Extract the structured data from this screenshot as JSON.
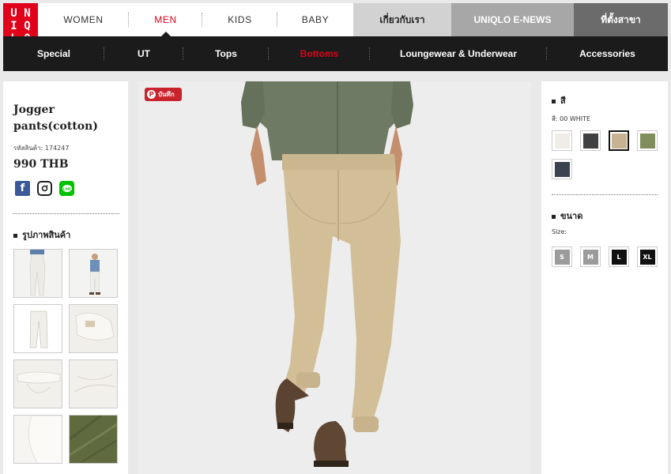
{
  "brand": {
    "logo_text": [
      "UNI",
      "QLO"
    ],
    "color": "#e0001a"
  },
  "global_nav": [
    {
      "label": "WOMEN",
      "active": false
    },
    {
      "label": "MEN",
      "active": true
    },
    {
      "label": "KIDS",
      "active": false
    },
    {
      "label": "BABY",
      "active": false
    }
  ],
  "external_links": [
    {
      "label": "เกี่ยวกับเรา",
      "bg": "#d2d2d2",
      "color": "#222"
    },
    {
      "label": "UNIQLO E-NEWS",
      "bg": "#a7a7a7",
      "color": "#fff"
    },
    {
      "label": "ที่ตั้งสาขา",
      "bg": "#6b6b6b",
      "color": "#fff"
    }
  ],
  "category_nav": [
    {
      "label": "Special",
      "active": false
    },
    {
      "label": "UT",
      "active": false
    },
    {
      "label": "Tops",
      "active": false
    },
    {
      "label": "Bottoms",
      "active": true
    },
    {
      "label": "Loungewear & Underwear",
      "active": false
    },
    {
      "label": "Accessories",
      "active": false
    }
  ],
  "product": {
    "name": "Jogger pants(cotton)",
    "code_label": "รหัสสินค้า: 174247",
    "price": "990 THB",
    "social": [
      "facebook-icon",
      "instagram-icon",
      "line-icon"
    ],
    "images_heading": "รูปภาพสินค้า"
  },
  "pin_button": {
    "label": "บันทึก"
  },
  "options": {
    "color_heading": "สี",
    "color_selected_label": "สี: 00 WHITE",
    "colors": [
      {
        "name": "white",
        "hex": "#f0ede6",
        "selected": false
      },
      {
        "name": "dark-gray",
        "hex": "#3f4042",
        "selected": false
      },
      {
        "name": "beige",
        "hex": "#c7b391",
        "selected": true
      },
      {
        "name": "olive",
        "hex": "#7f8e5c",
        "selected": false
      },
      {
        "name": "navy",
        "hex": "#3b4250",
        "selected": false
      }
    ],
    "size_heading": "ขนาด",
    "size_label": "Size:",
    "sizes": [
      {
        "label": "S",
        "available": false
      },
      {
        "label": "M",
        "available": false
      },
      {
        "label": "L",
        "available": true
      },
      {
        "label": "XL",
        "available": true
      }
    ]
  }
}
